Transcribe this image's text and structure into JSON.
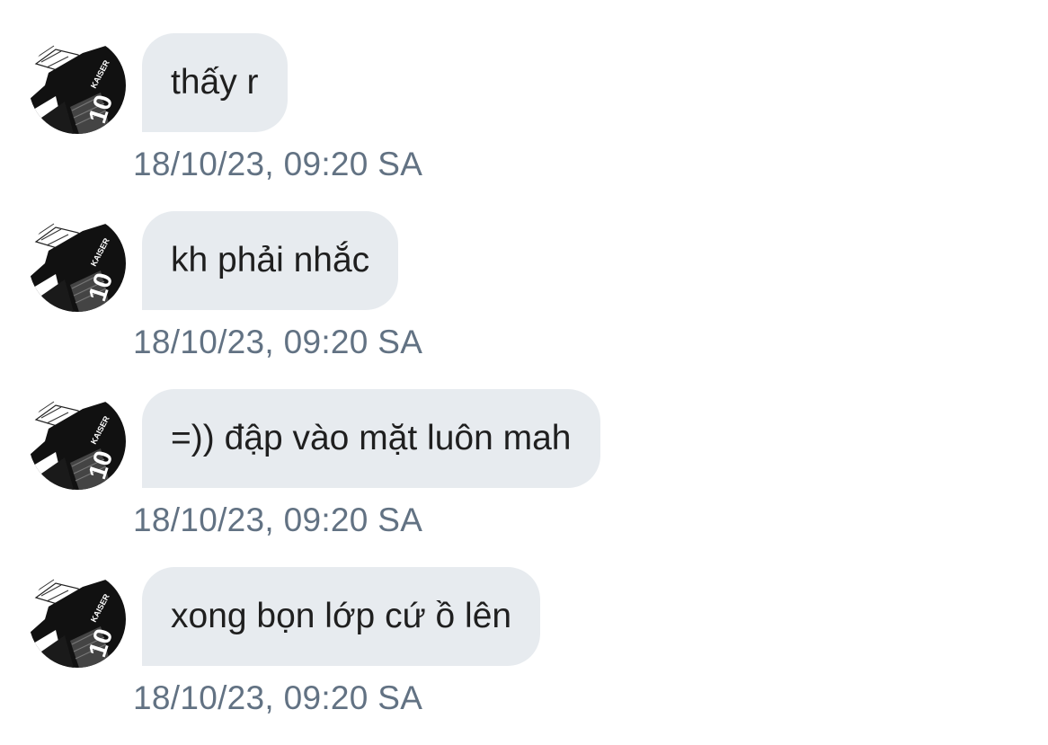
{
  "messages": [
    {
      "avatar_icon": "kaiser-jersey-avatar-icon",
      "text": "thấy r",
      "time": "18/10/23, 09:20 SA"
    },
    {
      "avatar_icon": "kaiser-jersey-avatar-icon",
      "text": "kh phải nhắc",
      "time": "18/10/23, 09:20 SA"
    },
    {
      "avatar_icon": "kaiser-jersey-avatar-icon",
      "text": "=)) đập vào mặt luôn mah",
      "time": "18/10/23, 09:20 SA"
    },
    {
      "avatar_icon": "kaiser-jersey-avatar-icon",
      "text": "xong bọn lớp cứ ồ lên",
      "time": "18/10/23, 09:20 SA"
    }
  ],
  "avatar_jersey": {
    "name": "KAISER",
    "number": "10"
  },
  "colors": {
    "bubble": "#e7ebef",
    "timestamp": "#627283",
    "text": "#1f1f1f"
  }
}
